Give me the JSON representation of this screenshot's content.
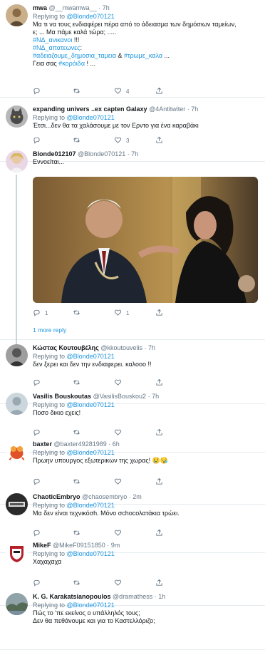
{
  "tweets": [
    {
      "name": "mwa",
      "handle": "@__mwamwa__",
      "time": "7h",
      "replying_label": "Replying to",
      "replying_to": "@Blonde070121",
      "lines": [
        [
          {
            "t": "Μα τι να τους ενδιαφέρει πέρα από το άδειασμα των δημόσιων ταμείων,"
          }
        ],
        [
          {
            "t": "ε; ... Μα πάμε καλά τώρα; ....."
          }
        ],
        [
          {
            "t": "#ΝΔ_ανικανοι",
            "tag": true
          },
          {
            "t": " !!!"
          }
        ],
        [
          {
            "t": "#ΝΔ_απατεωνες",
            "tag": true
          },
          {
            "t": ":"
          }
        ],
        [
          {
            "t": "#αδειαζουμε_δημοσια_ταμεια",
            "tag": true
          },
          {
            "t": " & "
          },
          {
            "t": "#τρωμε_καλα",
            "tag": true
          },
          {
            "t": " ..."
          }
        ],
        [
          {
            "t": "Γεια σας "
          },
          {
            "t": "#κορόιδα",
            "tag": true
          },
          {
            "t": " ! ..."
          }
        ]
      ],
      "reply_count": "",
      "rt_count": "",
      "like_count": "4"
    },
    {
      "name": "expanding univers ..ex capten Galaxy",
      "handle": "@4Antitwiter",
      "time": "7h",
      "replying_label": "Replying to",
      "replying_to": "@Blonde070121",
      "lines": [
        [
          {
            "t": "Έτσι...δεν θα τα χαλάσουμε με τον Ερντο για ένα καραβάκι"
          }
        ]
      ],
      "reply_count": "",
      "rt_count": "",
      "like_count": "3"
    },
    {
      "name": "Blonde012107",
      "handle": "@Blonde070121",
      "time": "7h",
      "replying_label": "",
      "replying_to": "",
      "lines": [
        [
          {
            "t": "Εννοείται..."
          }
        ]
      ],
      "reply_count": "1",
      "rt_count": "",
      "like_count": "1",
      "more_replies": "1 more reply"
    },
    {
      "name": "Κώστας Κουτουβέλης",
      "handle": "@kkoutouvelis",
      "time": "7h",
      "replying_label": "Replying to",
      "replying_to": "@Blonde070121",
      "lines": [
        [
          {
            "t": "δεν ξερει και δεν την ενδιαφερει. καλοοο !!"
          }
        ]
      ],
      "reply_count": "",
      "rt_count": "",
      "like_count": ""
    },
    {
      "name": "Vasilis Bouskoutas",
      "handle": "@VasilisBouskou2",
      "time": "7h",
      "replying_label": "Replying to",
      "replying_to": "@Blonde070121",
      "lines": [
        [
          {
            "t": "Ποσο δικιο εχεις!"
          }
        ]
      ],
      "reply_count": "",
      "rt_count": "",
      "like_count": ""
    },
    {
      "name": "baxter",
      "handle": "@baxter49281989",
      "time": "6h",
      "replying_label": "Replying to",
      "replying_to": "@Blonde070121",
      "lines": [
        [
          {
            "t": "Πρωην υπουργος εξωτερικων της χωρας! 😢😪"
          }
        ]
      ],
      "reply_count": "",
      "rt_count": "",
      "like_count": ""
    },
    {
      "name": "ChaoticEmbryo",
      "handle": "@chaosembryo",
      "time": "2m",
      "replying_label": "Replying to",
      "replying_to": "@Blonde070121",
      "lines": [
        [
          {
            "t": "Μα δεν είναι τεχνικόσh. Μόνο σchocολατάκια τρώει."
          }
        ]
      ],
      "reply_count": "",
      "rt_count": "",
      "like_count": ""
    },
    {
      "name": "MikeF",
      "handle": "@MikeF09151850",
      "time": "9m",
      "replying_label": "Replying to",
      "replying_to": "@Blonde070121",
      "lines": [
        [
          {
            "t": "Χαχαχαχα"
          }
        ]
      ],
      "reply_count": "",
      "rt_count": "",
      "like_count": ""
    },
    {
      "name": "K. G. Karakatsianopoulos",
      "handle": "@dramathess",
      "time": "1h",
      "replying_label": "Replying to",
      "replying_to": "@Blonde070121",
      "lines": [
        [
          {
            "t": "Πώς το 'πε εκείνος ο υπάλληλός τους;"
          }
        ],
        [
          {
            "t": "Δεν θα πεθάνουμε και για το Καστελλόριζο;"
          }
        ]
      ],
      "reply_count": "",
      "rt_count": "",
      "like_count": ""
    }
  ],
  "icons": {
    "reply": "reply-icon",
    "retweet": "retweet-icon",
    "like": "heart-icon",
    "share": "share-icon"
  },
  "colors": {
    "link": "#1b95e0",
    "muted": "#657786",
    "text": "#14171a"
  }
}
